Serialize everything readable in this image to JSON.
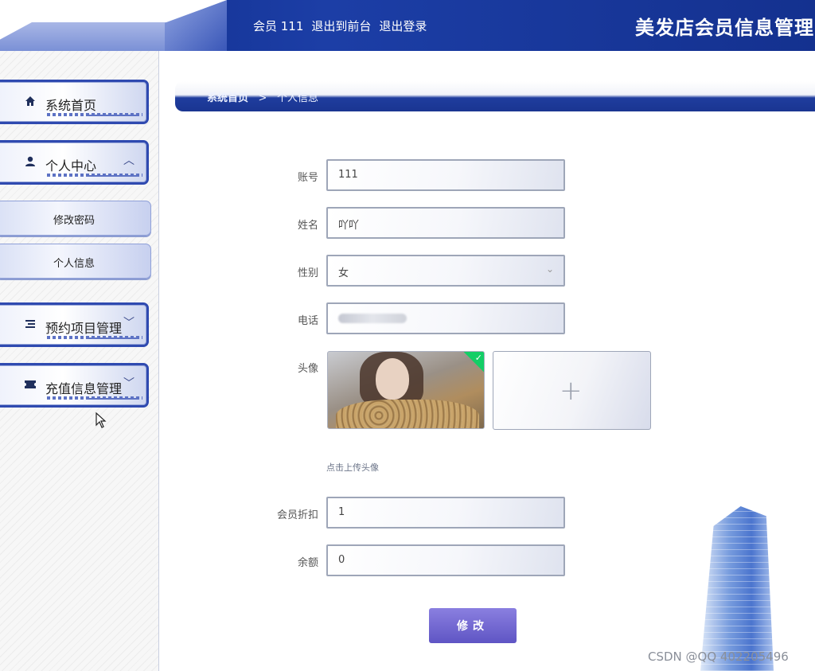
{
  "header": {
    "user_label": "会员 111",
    "back_link": "退出到前台",
    "logout_link": "退出登录",
    "site_title": "美发店会员信息管理系统"
  },
  "sidebar": {
    "items": [
      {
        "label": "系统首页",
        "icon": "home-icon"
      },
      {
        "label": "个人中心",
        "icon": "user-icon",
        "expanded": true,
        "children": [
          {
            "label": "修改密码"
          },
          {
            "label": "个人信息"
          }
        ]
      },
      {
        "label": "预约项目管理",
        "icon": "list-icon"
      },
      {
        "label": "充值信息管理",
        "icon": "ticket-icon"
      }
    ]
  },
  "breadcrumb": {
    "home": "系统首页",
    "separator": ">",
    "current": "个人信息"
  },
  "form": {
    "account": {
      "label": "账号",
      "value": "111"
    },
    "name": {
      "label": "姓名",
      "value": "吖吖"
    },
    "gender": {
      "label": "性别",
      "value": "女"
    },
    "phone": {
      "label": "电话",
      "value": ""
    },
    "avatar": {
      "label": "头像",
      "hint": "点击上传头像"
    },
    "discount": {
      "label": "会员折扣",
      "value": "1"
    },
    "balance": {
      "label": "余额",
      "value": "0"
    },
    "submit_label": "修改"
  },
  "icons": {
    "upload_plus": "+",
    "select_chevron": "⌄",
    "check": "✓"
  },
  "watermark": "CSDN @QQ 402205496",
  "colors": {
    "header_bg": "#1a3591",
    "menu_border": "#2f4ab0",
    "submit_bg": "#6a60cc",
    "upload_success": "#13ce66"
  }
}
